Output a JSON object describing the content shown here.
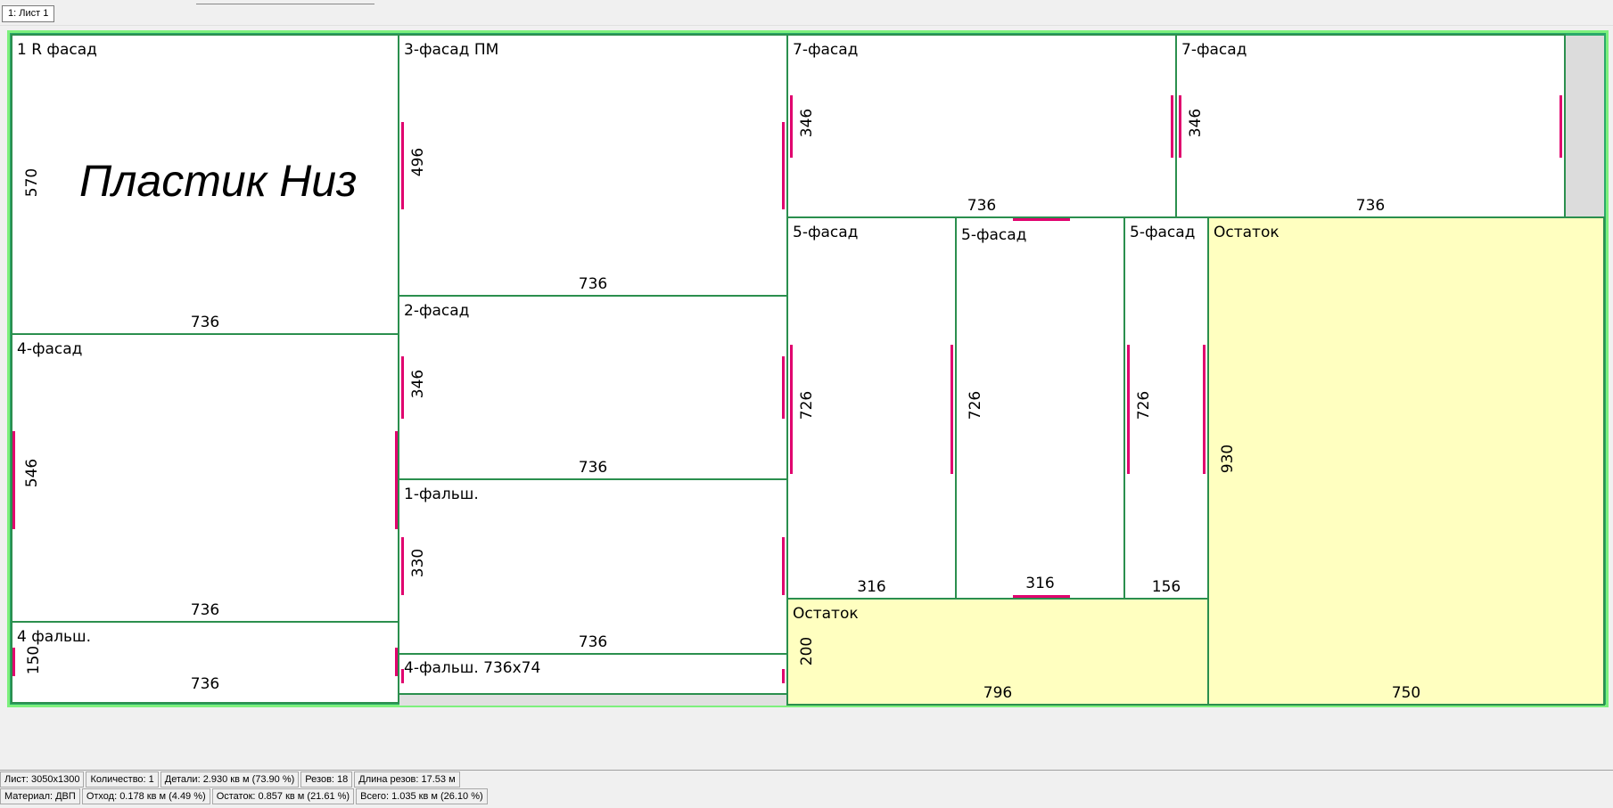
{
  "tab": {
    "label": "1: Лист 1"
  },
  "sheet": {
    "big_label": "Пластик Низ",
    "parts": [
      {
        "id": "p1",
        "name": "1 R фасад",
        "width": "736",
        "height": "570"
      },
      {
        "id": "p2",
        "name": "4-фасад",
        "width": "736",
        "height": "546"
      },
      {
        "id": "p3",
        "name": "4 фальш.",
        "width": "736",
        "height": "150"
      },
      {
        "id": "p4",
        "name": "3-фасад ПМ",
        "width": "736",
        "height": "496"
      },
      {
        "id": "p5",
        "name": "2-фасад",
        "width": "736",
        "height": "346"
      },
      {
        "id": "p6",
        "name": "1-фальш.",
        "width": "736",
        "height": "330"
      },
      {
        "id": "p7",
        "name": "4-фальш. 736x74"
      },
      {
        "id": "p8",
        "name": "7-фасад",
        "width": "736",
        "height": "346"
      },
      {
        "id": "p9",
        "name": "7-фасад",
        "width": "736",
        "height": "346"
      },
      {
        "id": "p10",
        "name": "5-фасад",
        "width": "316",
        "height": "726"
      },
      {
        "id": "p11",
        "name": "5-фасад",
        "width": "316",
        "height": "726"
      },
      {
        "id": "p12",
        "name": "5-фасад",
        "width": "156",
        "height": "726"
      },
      {
        "id": "r1",
        "name": "Остаток",
        "width": "750",
        "height": "930"
      },
      {
        "id": "r2",
        "name": "Остаток",
        "width": "796",
        "height": "200"
      }
    ]
  },
  "status": {
    "row1": [
      "Лист: 3050x1300",
      "Количество: 1",
      "Детали: 2.930 кв м (73.90 %)",
      "Резов: 18",
      "Длина резов: 17.53 м"
    ],
    "row2": [
      "Материал: ДВП",
      "Отход: 0.178 кв м (4.49 %)",
      "Остаток: 0.857 кв м (21.61 %)",
      "Всего: 1.035 кв м (26.10 %)"
    ]
  },
  "colors": {
    "part_border": "#2b8f4e",
    "rest_fill": "#ffffc0",
    "edge": "#e0006e",
    "board_frame": "#7df07d"
  }
}
